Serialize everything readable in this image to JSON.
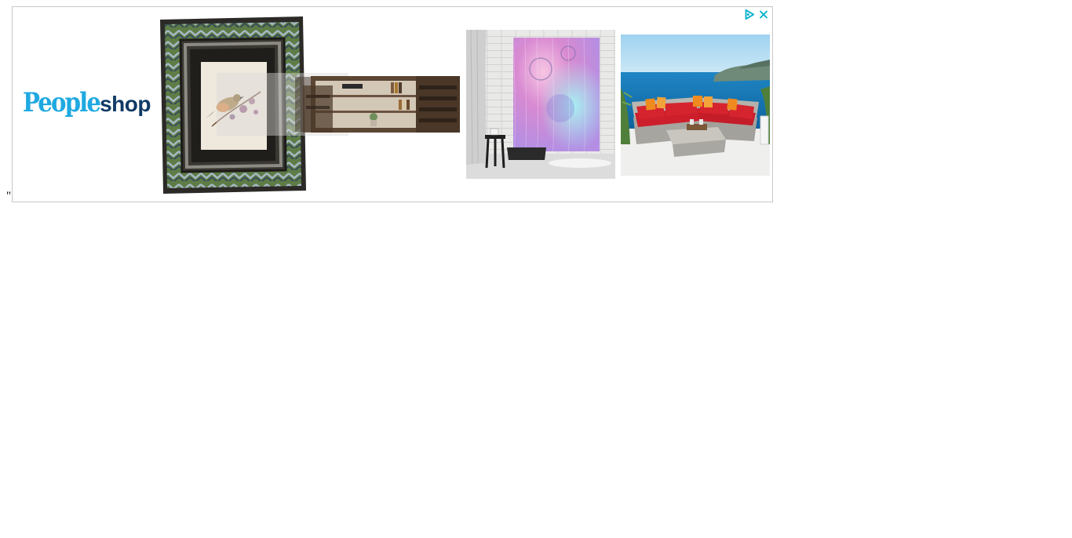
{
  "stray_text": "\"",
  "ad": {
    "brand": {
      "name_primary": "People",
      "name_secondary": "shop"
    },
    "controls": [
      {
        "name": "adchoices-icon"
      },
      {
        "name": "close-icon"
      }
    ],
    "colors": {
      "brand_blue": "#1fa9e1",
      "brand_navy": "#103a66",
      "adchoices": "#00aecd",
      "border": "#c8c8c8"
    },
    "products": [
      {
        "name": "ornate-bird-picture-frame"
      },
      {
        "name": "wood-media-console"
      },
      {
        "name": "watercolor-shower-curtain"
      },
      {
        "name": "red-wicker-sectional-sofa"
      }
    ]
  }
}
